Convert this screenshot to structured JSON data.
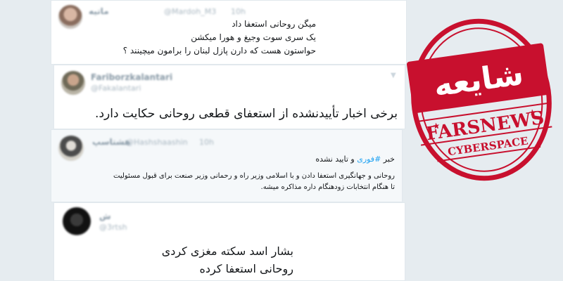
{
  "tweets": [
    {
      "name": "ماتيه",
      "handle": "@Mardoh_M3",
      "time": "10h",
      "lines": [
        "میگن روحانی استعفا داد",
        "یک سری سوت وجیغ و هورا میکشن",
        "حواستون هست که دارن پازل لبنان را برامون میچینند ؟"
      ]
    },
    {
      "name": "Fariborzkalantari",
      "handle": "@Fakalantari",
      "lines": [
        "برخی اخبار تأییدنشده از استعفای قطعی روحانی حکایت دارد."
      ]
    },
    {
      "name": "هشتاسپ",
      "handle": "@Hashshaashin",
      "time": "10h",
      "first_line_prefix": "خبر",
      "hashtag": "#فوری",
      "first_line_suffix": "و تایید نشده",
      "lines": [
        "روحانی و جهانگیری استعفا دادن و با اسلامی وزیر راه و رحمانی وزیر صنعت برای قبول مسئولیت",
        "تا هنگام انتخابات زودهنگام داره مذاکره میشه."
      ]
    },
    {
      "name": "ش",
      "handle": "@3rtsh",
      "lines": [
        "بشار اسد سکته مغزی کردی",
        "روحانی استعفا کرده"
      ]
    }
  ],
  "stamp": {
    "title": "شایعه",
    "brand": "FARSNEWS",
    "subtitle": "CYBERSPACE",
    "color": "#c8102e"
  },
  "colors": {
    "background": "#e6ecf0",
    "hashtag": "#1da1f2",
    "border": "#e1e8ed"
  }
}
